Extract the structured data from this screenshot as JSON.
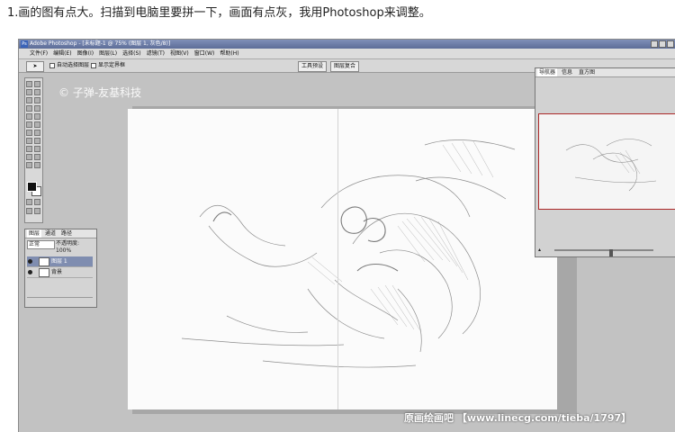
{
  "caption": "1.画的图有点大。扫描到电脑里要拼一下，画面有点灰，我用Photoshop来调整。",
  "window": {
    "title": "Adobe Photoshop - [未标题-1 @ 75% (图层 1, 灰色/8)]",
    "app_icon": "Ps"
  },
  "menu": [
    "文件(F)",
    "编辑(E)",
    "图像(I)",
    "图层(L)",
    "选择(S)",
    "滤镜(T)",
    "视图(V)",
    "窗口(W)",
    "帮助(H)"
  ],
  "options_bar": {
    "auto_select_label": "自动选择图层",
    "show_bounds_label": "显示定界框",
    "well_tabs": [
      "工具预设",
      "图层复合"
    ]
  },
  "watermark_top": "© 子弹-友基科技",
  "layers_panel": {
    "tabs": [
      "图层",
      "通道",
      "路径"
    ],
    "blend_mode": "正常",
    "opacity_label": "不透明度:",
    "opacity_value": "100%",
    "layers": [
      "图层 1",
      "背景"
    ]
  },
  "navigator_panel": {
    "tabs": [
      "导航器",
      "信息",
      "直方图"
    ],
    "zoom": 0.58
  },
  "bottom_watermark": "原画绘画吧 【www.linecg.com/tieba/1797】",
  "icons": {
    "move_tool": "move-arrow-icon",
    "eye": "eye-icon"
  }
}
